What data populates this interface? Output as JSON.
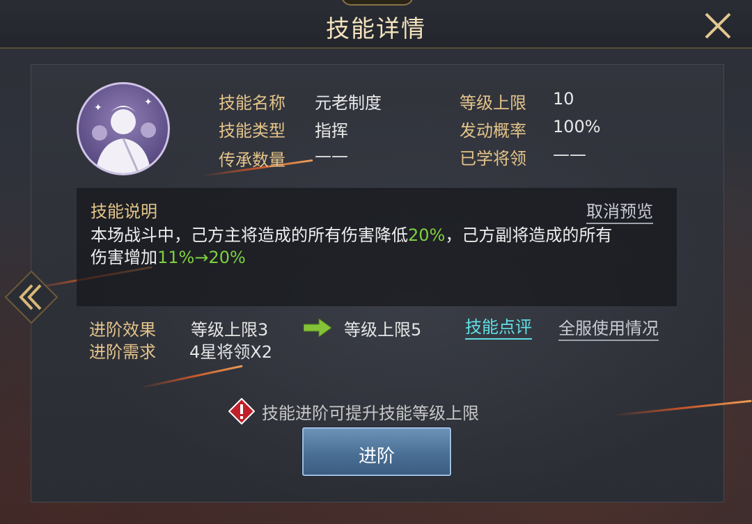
{
  "header": {
    "title": "技能详情"
  },
  "skill": {
    "rows": [
      {
        "label": "技能名称",
        "value": "元老制度"
      },
      {
        "label": "技能类型",
        "value": "指挥"
      },
      {
        "label": "传承数量",
        "value": "——"
      }
    ],
    "rows_right": [
      {
        "label": "等级上限",
        "value": "10"
      },
      {
        "label": "发动概率",
        "value": "100%"
      },
      {
        "label": "已学将领",
        "value": "——"
      }
    ]
  },
  "description": {
    "title": "技能说明",
    "cancel_preview": "取消预览",
    "line1_a": "本场战斗中，己方主将造成的所有伤害降低",
    "line1_b": "20%",
    "line1_c": "，己方副将造成的所有",
    "line2_a": "伤害增加",
    "line2_b": "11%→20%"
  },
  "advance": {
    "effect_label": "进阶效果",
    "effect_from": "等级上限3",
    "effect_to": "等级上限5",
    "require_label": "进阶需求",
    "require_value": "4星将领X2",
    "review_link": "技能点评",
    "usage_link": "全服使用情况",
    "hint": "技能进阶可提升技能等级上限",
    "button": "进阶"
  },
  "colors": {
    "label_gold": "#e4c48a",
    "highlight_green": "#7ed13f",
    "link_teal": "#5fe0e6",
    "button_blue": "#4a6f95"
  }
}
